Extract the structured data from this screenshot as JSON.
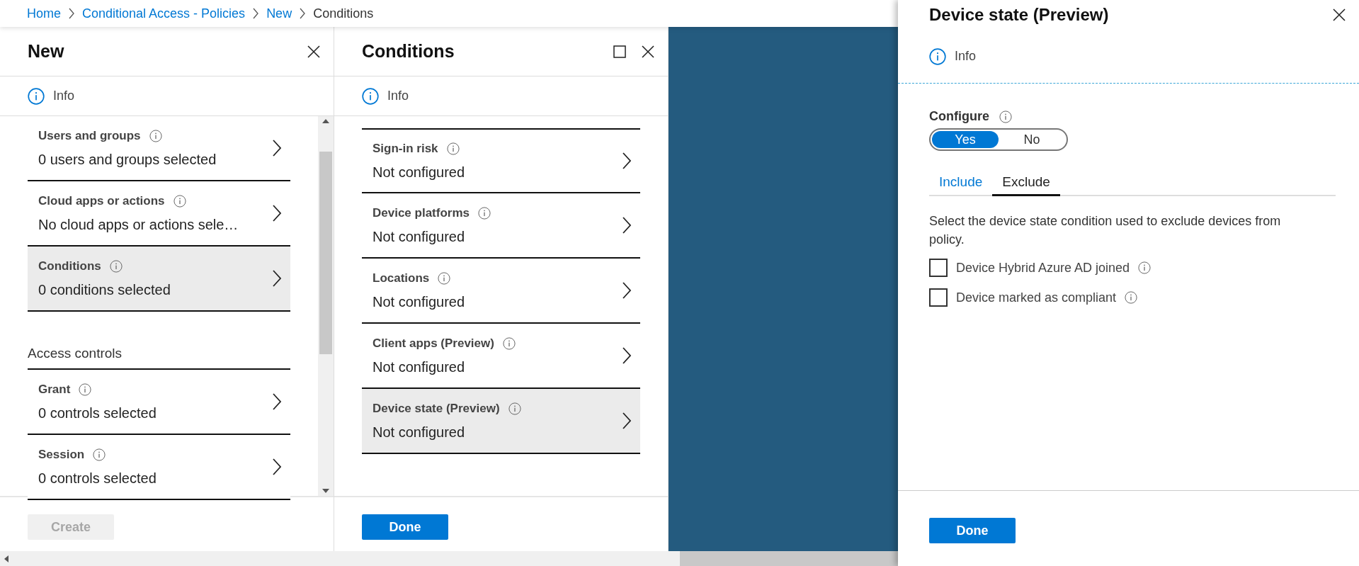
{
  "breadcrumb": [
    {
      "label": "Home",
      "link": true
    },
    {
      "label": "Conditional Access - Policies",
      "link": true
    },
    {
      "label": "New",
      "link": true
    },
    {
      "label": "Conditions",
      "link": false
    }
  ],
  "new_blade": {
    "title": "New",
    "info": "Info",
    "items": [
      {
        "label": "Users and groups",
        "value": "0 users and groups selected",
        "selected": false
      },
      {
        "label": "Cloud apps or actions",
        "value": "No cloud apps or actions sele…",
        "selected": false
      },
      {
        "label": "Conditions",
        "value": "0 conditions selected",
        "selected": true
      }
    ],
    "section": "Access controls",
    "access_items": [
      {
        "label": "Grant",
        "value": "0 controls selected",
        "selected": false
      },
      {
        "label": "Session",
        "value": "0 controls selected",
        "selected": false
      }
    ],
    "create_button": {
      "label": "Create",
      "disabled": true
    }
  },
  "conditions_blade": {
    "title": "Conditions",
    "info": "Info",
    "items": [
      {
        "label": "Sign-in risk",
        "value": "Not configured",
        "selected": false
      },
      {
        "label": "Device platforms",
        "value": "Not configured",
        "selected": false
      },
      {
        "label": "Locations",
        "value": "Not configured",
        "selected": false
      },
      {
        "label": "Client apps (Preview)",
        "value": "Not configured",
        "selected": false
      },
      {
        "label": "Device state (Preview)",
        "value": "Not configured",
        "selected": true
      }
    ],
    "done_button": "Done"
  },
  "device_state_blade": {
    "title": "Device state (Preview)",
    "info": "Info",
    "configure": {
      "label": "Configure",
      "options": [
        {
          "label": "Yes",
          "selected": true
        },
        {
          "label": "No",
          "selected": false
        }
      ]
    },
    "tabs": [
      {
        "label": "Include",
        "selected": false
      },
      {
        "label": "Exclude",
        "selected": true
      }
    ],
    "description": "Select the device state condition used to exclude devices from policy.",
    "checkboxes": [
      {
        "label": "Device Hybrid Azure AD joined",
        "checked": false
      },
      {
        "label": "Device marked as compliant",
        "checked": false
      }
    ],
    "done_button": "Done"
  }
}
